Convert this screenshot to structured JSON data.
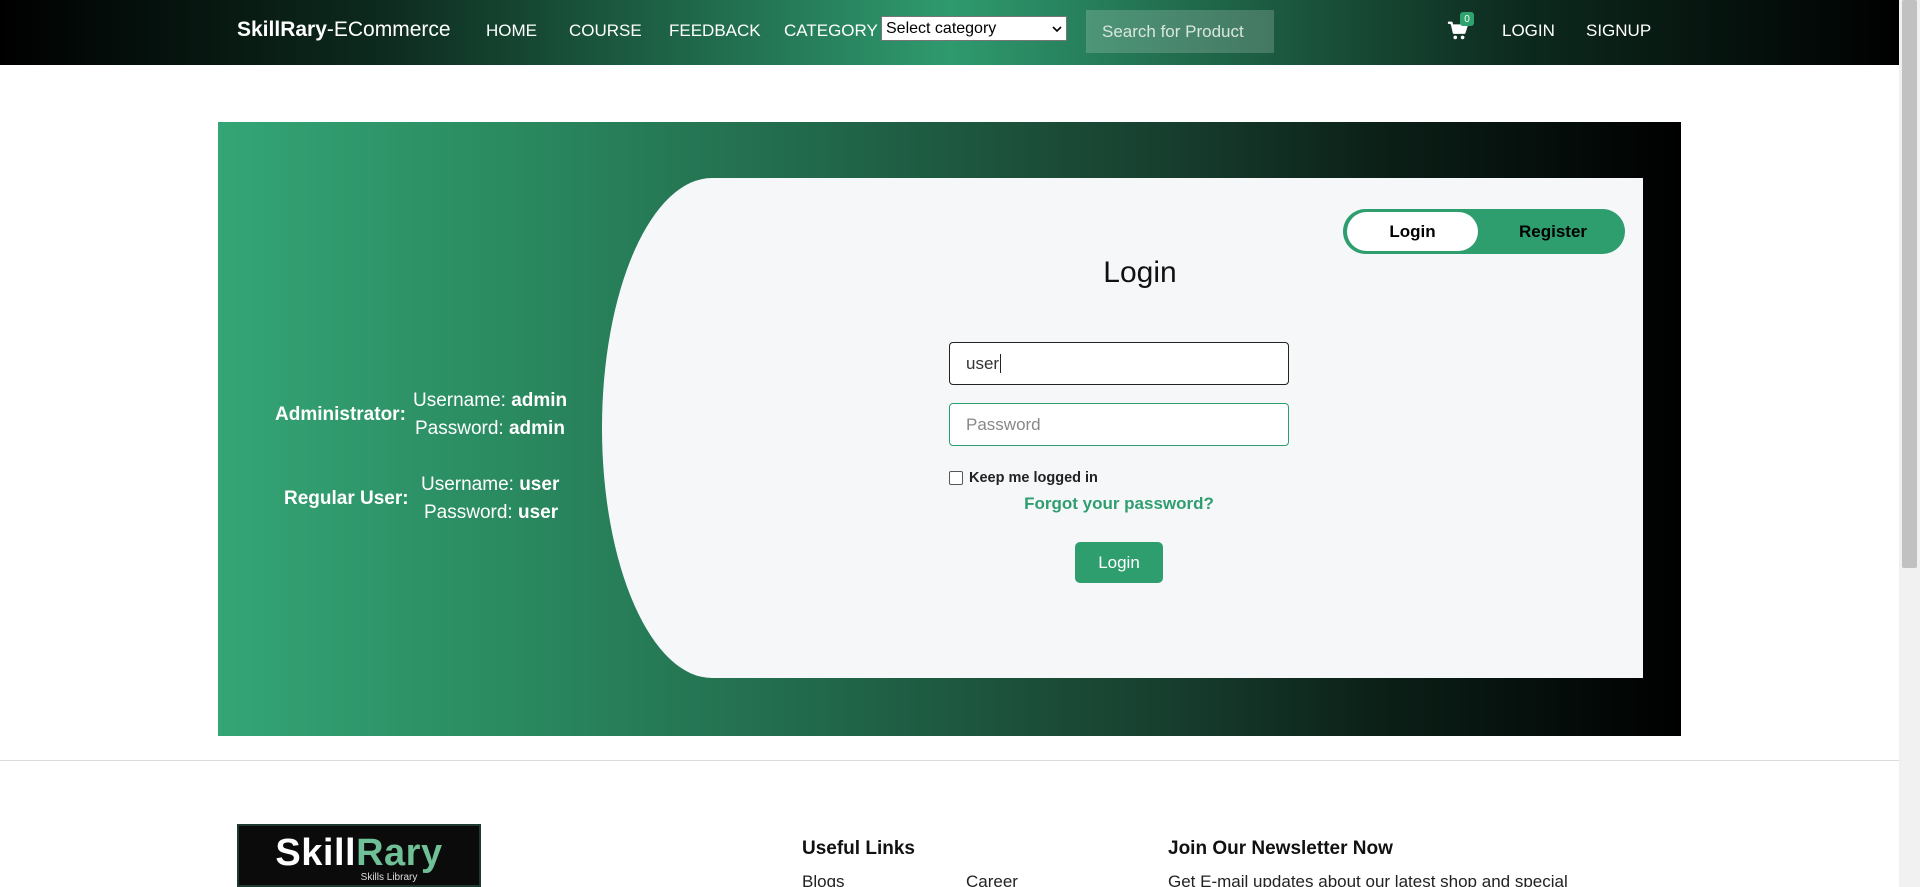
{
  "navbar": {
    "brand_bold": "SkillRary",
    "brand_rest": "-ECommerce",
    "links": [
      "HOME",
      "COURSE",
      "FEEDBACK",
      "CATEGORY"
    ],
    "category_select": "Select category",
    "search_placeholder": "Search for Product",
    "cart_count": "0",
    "login": "LOGIN",
    "signup": "SIGNUP"
  },
  "credentials": {
    "admin_role": "Administrator:",
    "admin_username_label": "Username: ",
    "admin_username": "admin",
    "admin_password_label": "Password: ",
    "admin_password": "admin",
    "user_role": "Regular User:",
    "user_username_label": "Username: ",
    "user_username": "user",
    "user_password_label": "Password: ",
    "user_password": "user"
  },
  "login_card": {
    "toggle_login": "Login",
    "toggle_register": "Register",
    "title": "Login",
    "username_value": "user",
    "password_placeholder": "Password",
    "keep_logged_in": "Keep me logged in",
    "forgot": "Forgot your password?",
    "submit": "Login"
  },
  "footer": {
    "logo_skill": "Skill",
    "logo_rary": "Rary",
    "logo_sub": "Skills Library",
    "useful_links": "Useful Links",
    "link_blogs": "Blogs",
    "link_career": "Career",
    "newsletter_title": "Join Our Newsletter Now",
    "newsletter_text": "Get E-mail updates about our latest shop and special"
  },
  "colors": {
    "accent": "#2f9e6f",
    "nav_dark": "#000000",
    "card_bg": "#f6f7f9"
  },
  "icons": [
    "chevron-down-icon",
    "cart-icon"
  ]
}
